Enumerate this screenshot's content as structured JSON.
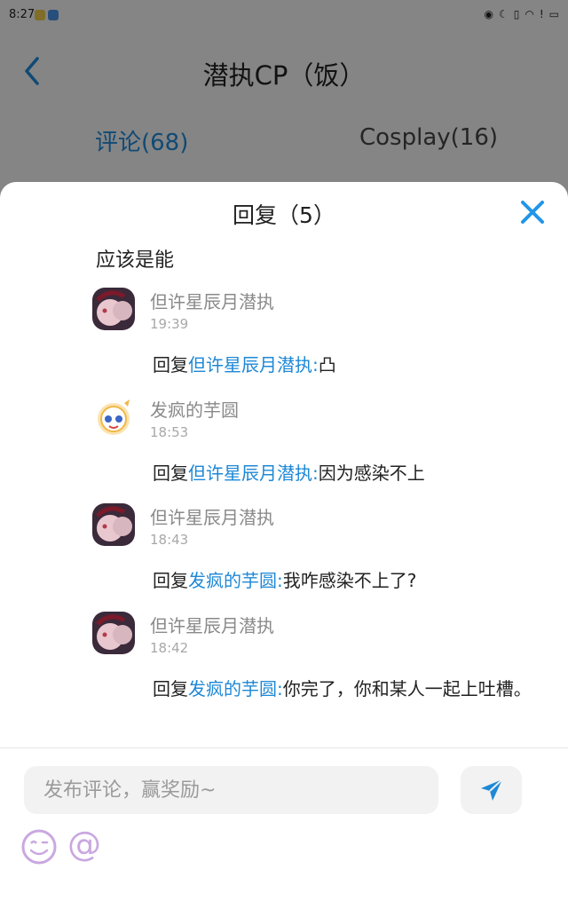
{
  "status_bar": {
    "time": "8:27",
    "right_icons": [
      "eye-icon",
      "moon-icon",
      "vibrate-icon",
      "wifi-icon",
      "alert-icon",
      "battery-icon"
    ]
  },
  "header": {
    "title": "潜执CP（饭）"
  },
  "tabs": [
    {
      "label": "评论(68)",
      "active": true
    },
    {
      "label": "Cosplay(16)",
      "active": false
    }
  ],
  "sheet": {
    "title": "回复（5）",
    "origin_comment": "应该是能",
    "replies": [
      {
        "user": "但许星辰月潜执",
        "time": "19:39",
        "prefix": "回复",
        "target": "但许星辰月潜执:",
        "text": "凸"
      },
      {
        "user": "发疯的芋圆",
        "time": "18:53",
        "prefix": "回复",
        "target": "但许星辰月潜执:",
        "text": "因为感染不上"
      },
      {
        "user": "但许星辰月潜执",
        "time": "18:43",
        "prefix": "回复",
        "target": "发疯的芋圆:",
        "text": "我咋感染不上了?"
      },
      {
        "user": "但许星辰月潜执",
        "time": "18:42",
        "prefix": "回复",
        "target": "发疯的芋圆:",
        "text": "你完了，你和某人一起上吐槽。"
      }
    ]
  },
  "composer": {
    "placeholder": "发布评论，赢奖励~",
    "mention_symbol": "@"
  },
  "colors": {
    "accent": "#1e88d6",
    "close": "#2196e8",
    "mention": "#c9a8e0"
  }
}
